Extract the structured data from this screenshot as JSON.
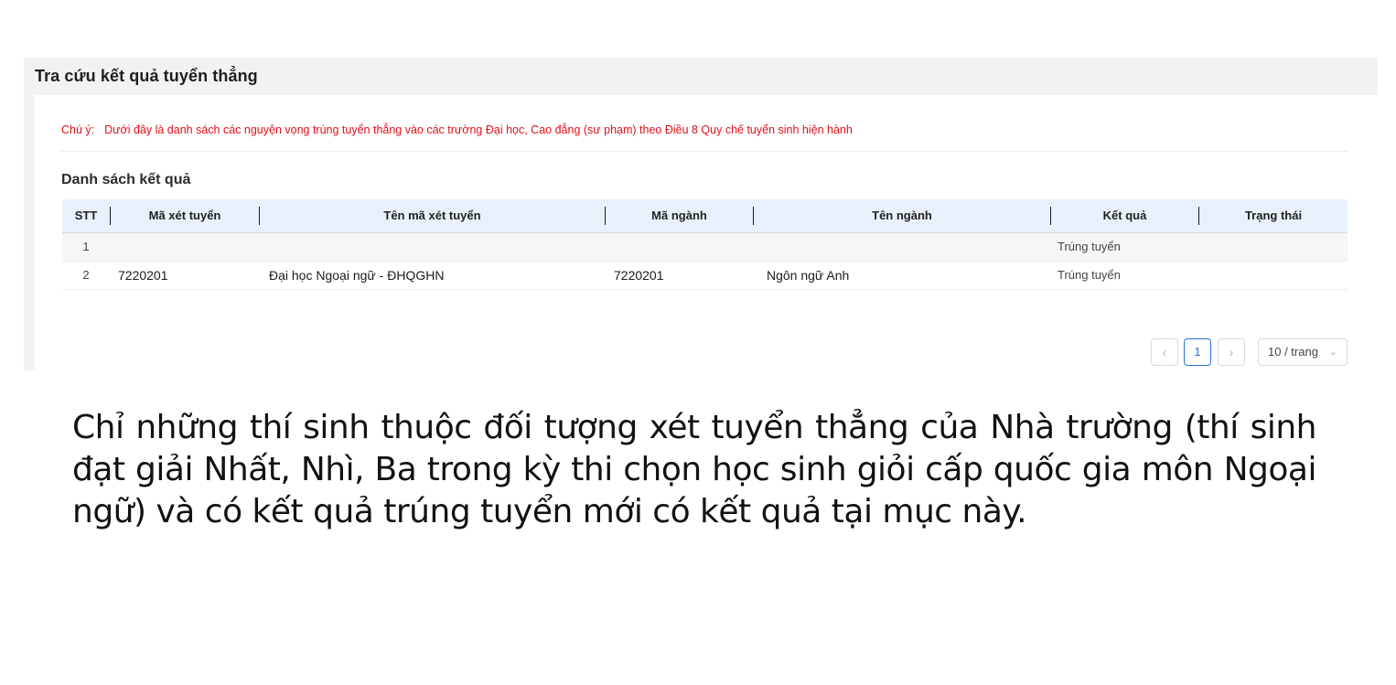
{
  "panel": {
    "title": "Tra cứu kết quả tuyển thẳng",
    "notice_label": "Chú ý:",
    "notice_text": "Dưới đây là danh sách các nguyện vọng trúng tuyển thẳng vào các trường Đại học, Cao đẳng (sư phạm) theo Điều 8 Quy chế tuyển sinh hiện hành",
    "section_title": "Danh sách kết quả"
  },
  "table": {
    "headers": {
      "stt": "STT",
      "ma_xet_tuyen": "Mã xét tuyển",
      "ten_ma_xet_tuyen": "Tên mã xét tuyển",
      "ma_nganh": "Mã ngành",
      "ten_nganh": "Tên ngành",
      "ket_qua": "Kết quả",
      "trang_thai": "Trạng thái"
    },
    "rows": [
      {
        "stt": "1",
        "ma_xet_tuyen": "",
        "ten_ma_xet_tuyen": "",
        "ma_nganh": "",
        "ten_nganh": "",
        "ket_qua": "Trúng tuyển",
        "trang_thai": ""
      },
      {
        "stt": "2",
        "ma_xet_tuyen": "7220201",
        "ten_ma_xet_tuyen": "Đại học Ngoại ngữ - ĐHQGHN",
        "ma_nganh": "7220201",
        "ten_nganh": "Ngôn ngữ Anh",
        "ket_qua": "Trúng tuyển",
        "trang_thai": ""
      }
    ]
  },
  "pagination": {
    "prev_icon": "‹",
    "current_page": "1",
    "next_icon": "›",
    "page_size": "10 / trang",
    "dropdown_icon": "⌄"
  },
  "caption": "Chỉ những thí sinh thuộc đối tượng xét tuyển thẳng của Nhà trường (thí sinh đạt giải Nhất, Nhì, Ba trong kỳ thi chọn học sinh giỏi cấp quốc gia môn Ngoại ngữ) và có kết quả trúng tuyển mới có kết quả tại mục này."
}
